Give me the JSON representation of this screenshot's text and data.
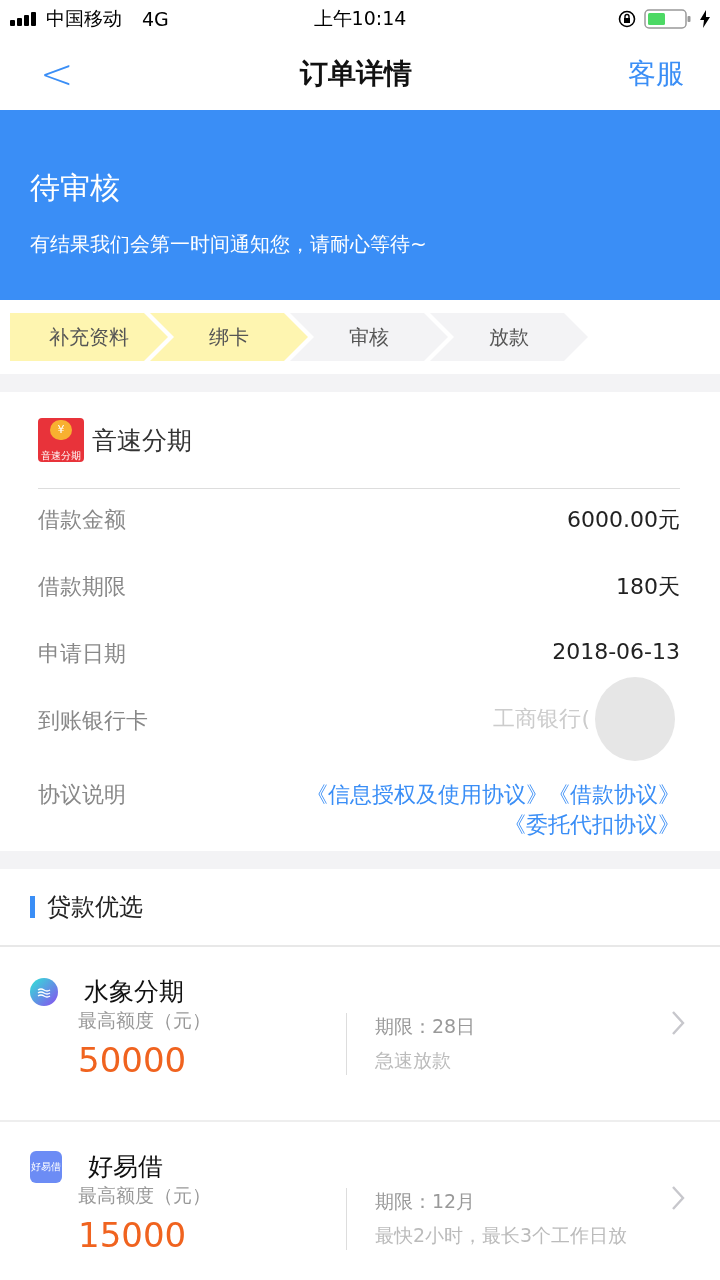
{
  "status_bar": {
    "carrier": "中国移动",
    "network": "4G",
    "time": "上午10:14"
  },
  "nav": {
    "back": "<",
    "title": "订单详情",
    "action": "客服"
  },
  "banner": {
    "title": "待审核",
    "message": "有结果我们会第一时间通知您，请耐心等待~"
  },
  "steps": [
    {
      "label": "补充资料",
      "done": true
    },
    {
      "label": "绑卡",
      "done": true
    },
    {
      "label": "审核",
      "done": false
    },
    {
      "label": "放款",
      "done": false
    }
  ],
  "order": {
    "app_name": "音速分期",
    "app_icon_label": "音速分期",
    "app_icon_symbol": "¥",
    "rows": [
      {
        "kind": "text",
        "label": "借款金额",
        "value": "6000.00元"
      },
      {
        "kind": "text",
        "label": "借款期限",
        "value": "180天"
      },
      {
        "kind": "text",
        "label": "申请日期",
        "value": "2018-06-13"
      },
      {
        "kind": "masked",
        "label": "到账银行卡",
        "value": "工商银行("
      },
      {
        "kind": "links",
        "label": "协议说明",
        "links": [
          "《信息授权及使用协议》",
          "《借款协议》",
          "《委托代扣协议》"
        ]
      }
    ]
  },
  "recommend": {
    "title": "贷款优选",
    "items": [
      {
        "kind": "wave",
        "name": "水象分期",
        "limit_label": "最高额度（元）",
        "amount": "50000",
        "term": "期限：28日",
        "note": "急速放款"
      },
      {
        "kind": "badge",
        "icon_label": "好易借",
        "name": "好易借",
        "limit_label": "最高额度（元）",
        "amount": "15000",
        "term": "期限：12月",
        "note": "最快2小时，最长3个工作日放"
      }
    ]
  }
}
